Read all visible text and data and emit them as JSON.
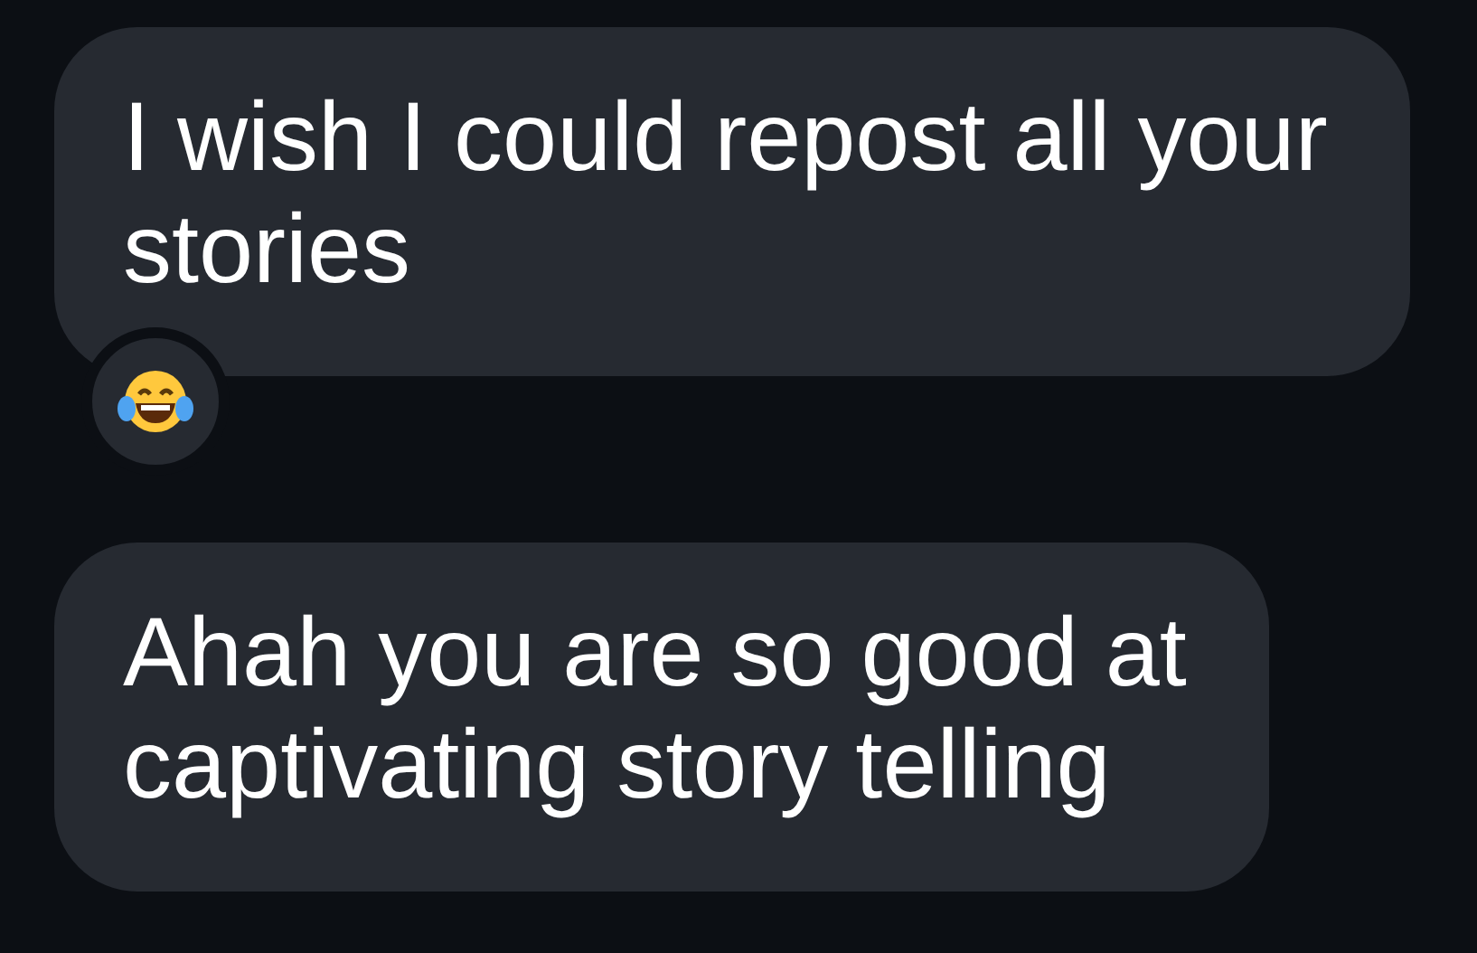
{
  "messages": [
    {
      "text": "I wish I could repost all your stories",
      "reacted": true
    },
    {
      "text": "Ahah you are so good at captivating story telling",
      "reacted": false
    }
  ]
}
